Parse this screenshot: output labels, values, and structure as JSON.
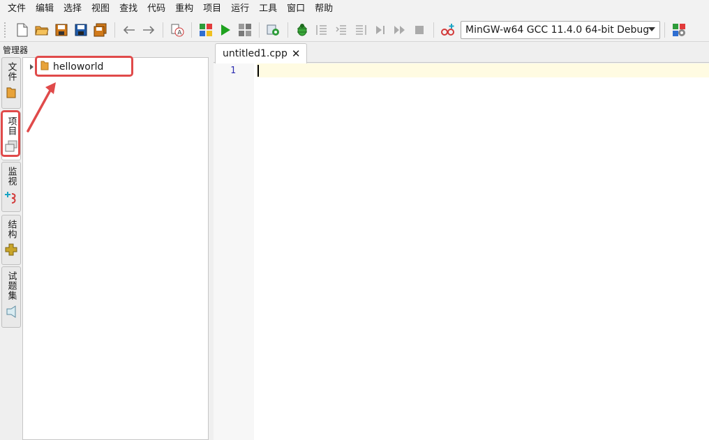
{
  "menubar": {
    "items": [
      "文件",
      "编辑",
      "选择",
      "视图",
      "查找",
      "代码",
      "重构",
      "项目",
      "运行",
      "工具",
      "窗口",
      "帮助"
    ]
  },
  "toolbar": {
    "icons": [
      "new-file-icon",
      "open-folder-icon",
      "save-icon",
      "save-as-icon",
      "save-all-icon",
      "undo-arrow-icon",
      "redo-arrow-icon",
      "font-settings-icon",
      "compile-icon",
      "run-icon",
      "compile-run-icon",
      "options-icon",
      "debug-bug-icon",
      "step-into-icon",
      "step-over-icon",
      "step-out-icon",
      "run-to-cursor-icon",
      "continue-icon",
      "stop-icon",
      "add-watch-icon",
      "compiler-options-icon"
    ],
    "compiler_select": "MinGW-w64 GCC 11.4.0 64-bit Debug"
  },
  "manager": {
    "title": "管理器",
    "tabs": [
      {
        "label": "文件",
        "icon": "folder-icon"
      },
      {
        "label": "项目",
        "icon": "project-icon"
      },
      {
        "label": "监视",
        "icon": "watch-icon"
      },
      {
        "label": "结构",
        "icon": "structure-icon"
      },
      {
        "label": "试题集",
        "icon": "problem-set-icon"
      }
    ],
    "active_tab": "项目",
    "tree": {
      "project_name": "helloworld"
    }
  },
  "editor": {
    "tab_title": "untitled1.cpp",
    "line_numbers": [
      "1"
    ],
    "content": ""
  },
  "colors": {
    "annotation": "#e04a4a",
    "current_line": "#fffbe2",
    "line_number": "#2d2db0"
  }
}
